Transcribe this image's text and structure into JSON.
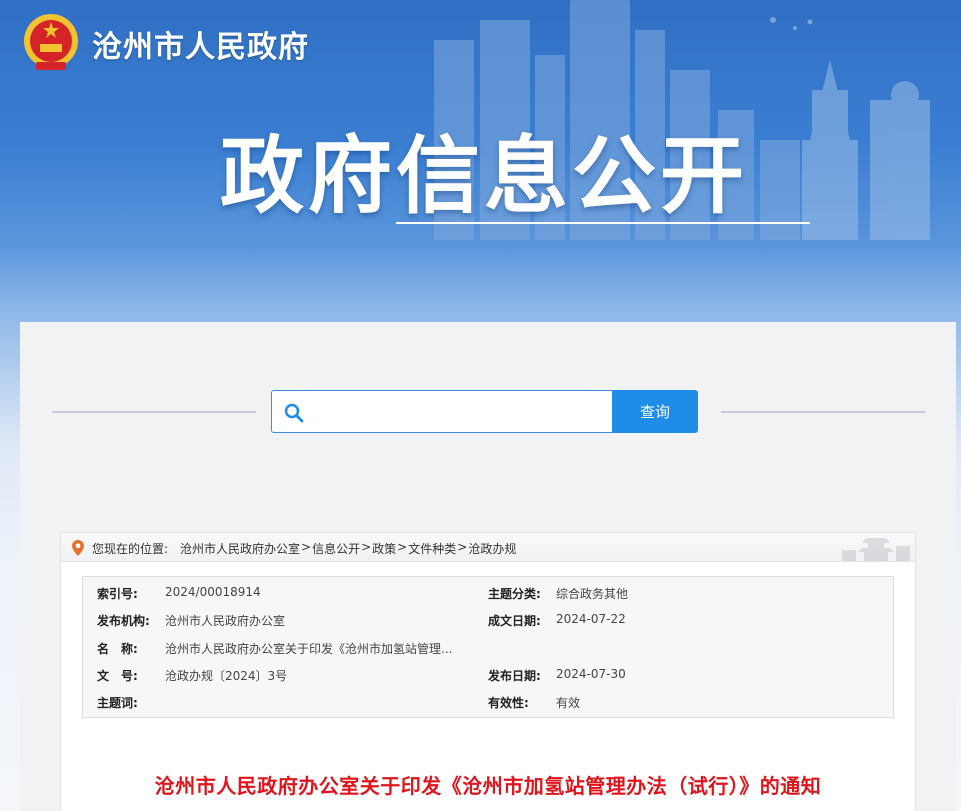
{
  "header": {
    "site_title": "沧州市人民政府",
    "banner_title": "政府信息公开"
  },
  "search": {
    "placeholder": "",
    "button_label": "查询"
  },
  "breadcrumb": {
    "prefix": "您现在的位置:",
    "items": [
      "沧州市人民政府办公室",
      "信息公开",
      "政策",
      "文件种类",
      "沧政办规"
    ],
    "separator": ">"
  },
  "meta": {
    "index_label": "索引号:",
    "index_value": "2024/00018914",
    "topic_label": "主题分类:",
    "topic_value": "综合政务其他",
    "issuer_label": "发布机构:",
    "issuer_value": "沧州市人民政府办公室",
    "created_label": "成文日期:",
    "created_value": "2024-07-22",
    "name_label": "名　称:",
    "name_value": "沧州市人民政府办公室关于印发《沧州市加氢站管理...",
    "docno_label": "文　号:",
    "docno_value": "沧政办规〔2024〕3号",
    "published_label": "发布日期:",
    "published_value": "2024-07-30",
    "keywords_label": "主题词:",
    "keywords_value": "",
    "validity_label": "有效性:",
    "validity_value": "有效"
  },
  "document": {
    "title": "沧州市人民政府办公室关于印发《沧州市加氢站管理办法（试行）》的通知"
  },
  "colors": {
    "accent": "#1f8ce8",
    "title_red": "#e0141c",
    "banner_blue": "#3b7fd2"
  },
  "icons": {
    "emblem": "national-emblem-icon",
    "search": "search-icon",
    "location": "location-pin-icon"
  }
}
